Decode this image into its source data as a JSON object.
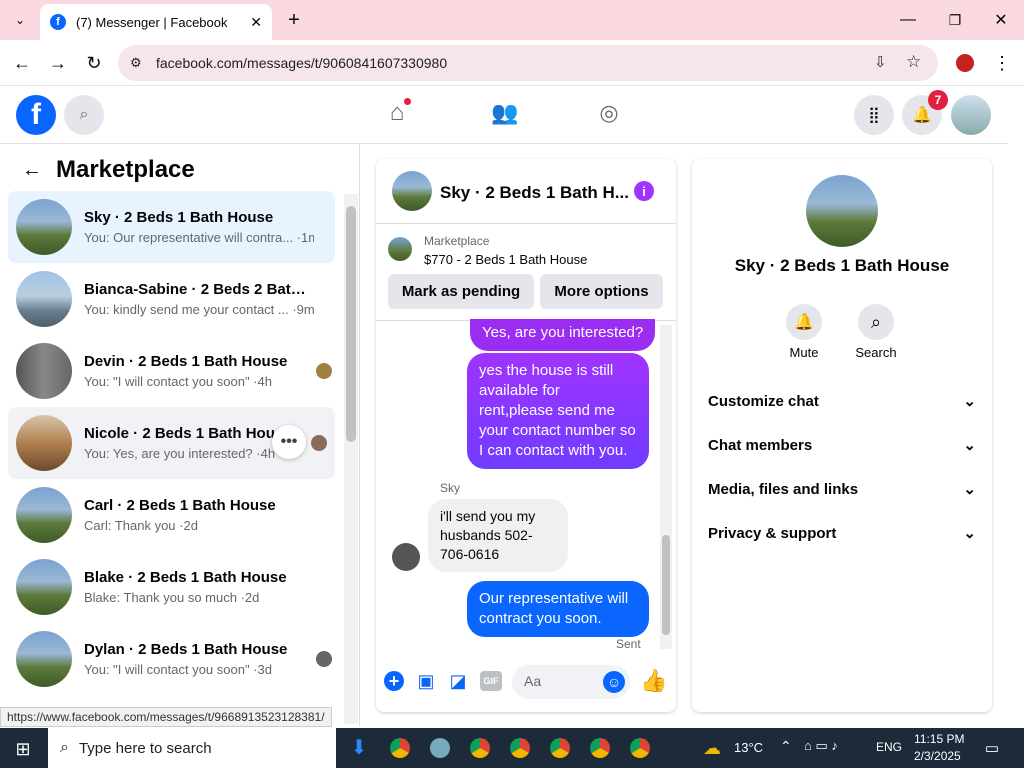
{
  "browser": {
    "tab_title": "(7) Messenger | Facebook",
    "url": "facebook.com/messages/t/9060841607330980",
    "status_url": "https://www.facebook.com/messages/t/9668913523128381/"
  },
  "header": {
    "notification_count": "7"
  },
  "left": {
    "title": "Marketplace",
    "conversations": [
      {
        "name": "Sky · 2 Beds 1 Bath House",
        "preview": "You: Our representative will contra... ·1m"
      },
      {
        "name": "Bianca-Sabine · 2 Beds 2 Baths ...",
        "preview": "You: kindly send me your contact ... ·9m"
      },
      {
        "name": "Devin · 2 Beds 1 Bath House",
        "preview": "You: \"I will contact you soon\" ·4h"
      },
      {
        "name": "Nicole · 2 Beds 1 Bath House",
        "preview": "You: Yes, are you interested? ·4h"
      },
      {
        "name": "Carl · 2 Beds 1 Bath House",
        "preview": "Carl: Thank you ·2d"
      },
      {
        "name": "Blake · 2 Beds 1 Bath House",
        "preview": "Blake: Thank you so much ·2d"
      },
      {
        "name": "Dylan · 2 Beds 1 Bath House",
        "preview": "You: \"I will contact you soon\" ·3d"
      }
    ]
  },
  "chat": {
    "title": "Sky · 2 Beds 1 Bath H...",
    "listing_source": "Marketplace",
    "listing": "$770 - 2 Beds 1 Bath House",
    "mark_pending": "Mark as pending",
    "more_options": "More options",
    "messages": [
      "Yes, are you interested?",
      "yes the house is still available for rent,please send me your contact number so I can contact with you.",
      "i'll send you my husbands 502-706-0616",
      "Our representative will contract you soon."
    ],
    "sender": "Sky",
    "sent_label": "Sent",
    "input_placeholder": "Aa"
  },
  "right": {
    "title": "Sky · 2 Beds 1 Bath House",
    "mute": "Mute",
    "search": "Search",
    "sections": [
      "Customize chat",
      "Chat members",
      "Media, files and links",
      "Privacy & support"
    ]
  },
  "taskbar": {
    "search_placeholder": "Type here to search",
    "temp": "13°C",
    "lang": "ENG",
    "time": "11:15 PM",
    "date": "2/3/2025"
  },
  "colors": {
    "accent": "#0866ff",
    "purple": "#a033ff"
  }
}
